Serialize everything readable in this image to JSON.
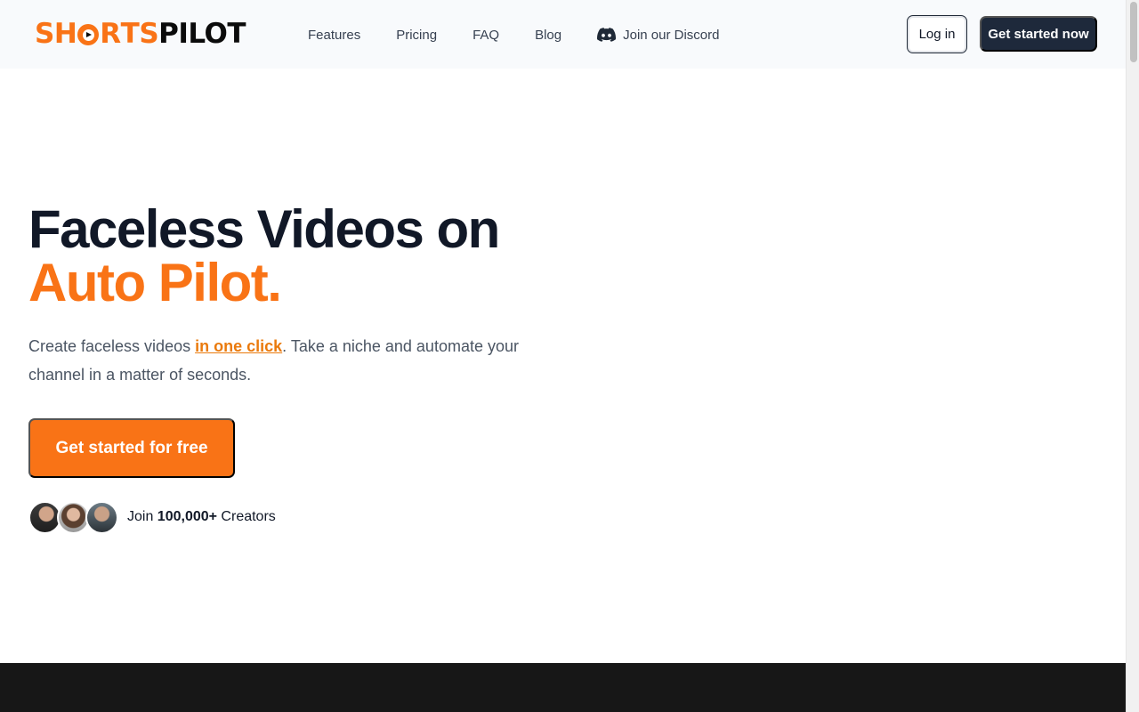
{
  "brand": {
    "part_a": "SHORTS",
    "part_b": "PILOT",
    "accent_color": "#f97316",
    "dark_color": "#1e293b"
  },
  "nav": {
    "items": [
      {
        "label": "Features"
      },
      {
        "label": "Pricing"
      },
      {
        "label": "FAQ"
      },
      {
        "label": "Blog"
      }
    ],
    "discord": {
      "label": "Join our Discord",
      "icon": "discord-icon"
    }
  },
  "header_actions": {
    "login_label": "Log in",
    "start_label": "Get started now"
  },
  "hero": {
    "title_line1": "Faceless Videos on",
    "title_line2": "Auto Pilot.",
    "subtitle_before": "Create faceless videos ",
    "subtitle_highlight": "in one click",
    "subtitle_after": ". Take a niche and automate your channel in a matter of seconds.",
    "cta_label": "Get started for free"
  },
  "social_proof": {
    "prefix": "Join ",
    "count": "100,000+",
    "suffix": " Creators"
  }
}
